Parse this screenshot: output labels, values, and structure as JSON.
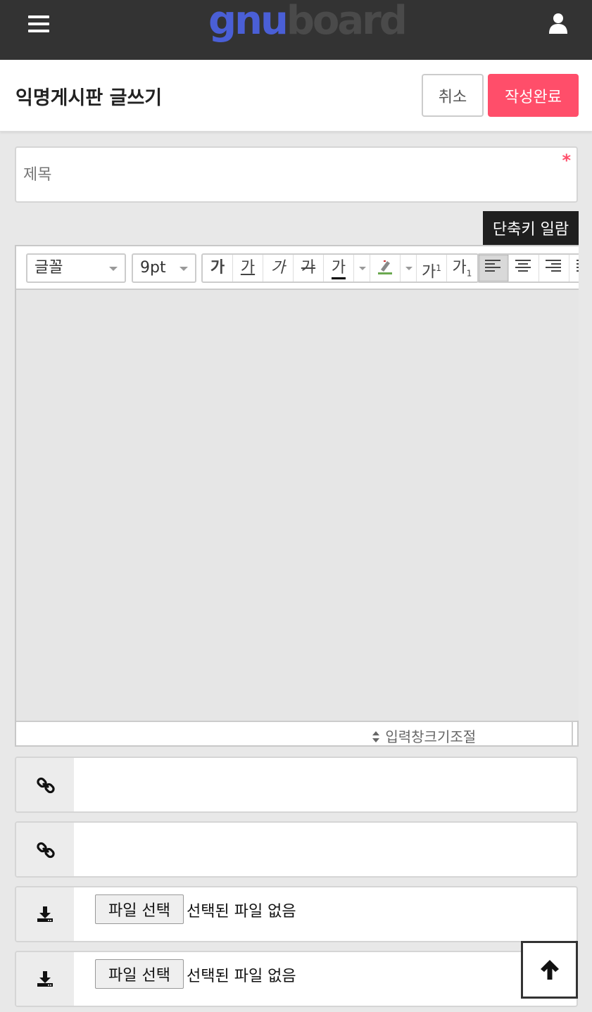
{
  "header": {
    "logo_part1": "gnu",
    "logo_part2": "board"
  },
  "titlebar": {
    "title": "익명게시판 글쓰기",
    "cancel_label": "취소",
    "submit_label": "작성완료"
  },
  "subject": {
    "placeholder": "제목",
    "required_mark": "*"
  },
  "shortcut_label": "단축키 일람",
  "editor": {
    "font_select": "글꼴",
    "size_select": "9pt",
    "buttons": {
      "bold": "가",
      "underline": "가",
      "italic": "가",
      "strike": "가",
      "font_color": "가",
      "superscript": "가",
      "subscript": "가"
    },
    "resize_label": "입력창크기조절"
  },
  "files": [
    {
      "button_label": "파일 선택",
      "status": "선택된 파일 없음"
    },
    {
      "button_label": "파일 선택",
      "status": "선택된 파일 없음"
    }
  ],
  "colors": {
    "accent": "#ff4e6a",
    "header_bg": "#333333",
    "logo_blue": "#4a5fd6"
  }
}
